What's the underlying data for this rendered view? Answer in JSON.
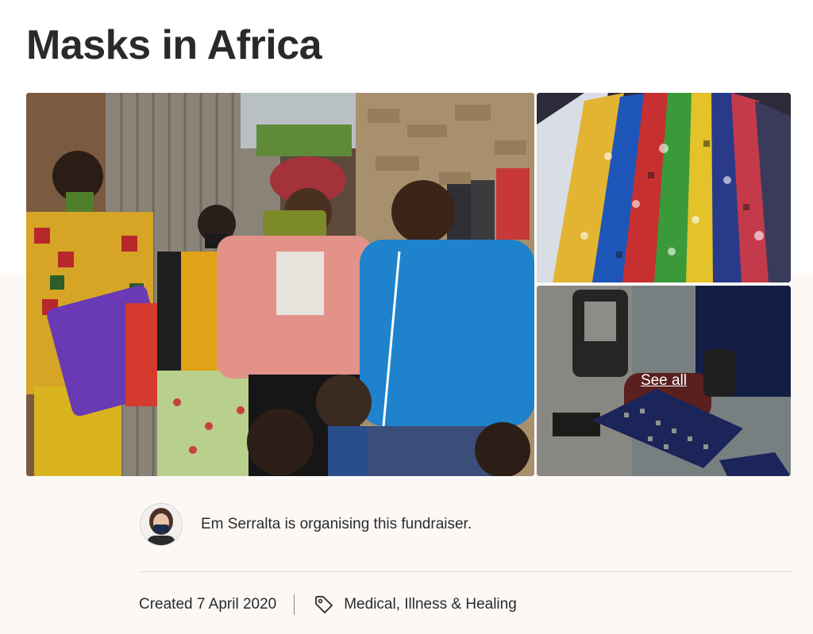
{
  "page": {
    "title": "Masks in Africa"
  },
  "gallery": {
    "see_all_label": "See all",
    "main_photo_icon": "photo-group-people-masks",
    "thumb_top_icon": "photo-fabric-rolls",
    "thumb_bottom_icon": "photo-sewing-machine"
  },
  "organiser": {
    "text": "Em Serralta is organising this fundraiser."
  },
  "meta": {
    "created": "Created 7 April 2020",
    "category": "Medical, Illness & Healing",
    "category_icon": "tag-icon"
  }
}
